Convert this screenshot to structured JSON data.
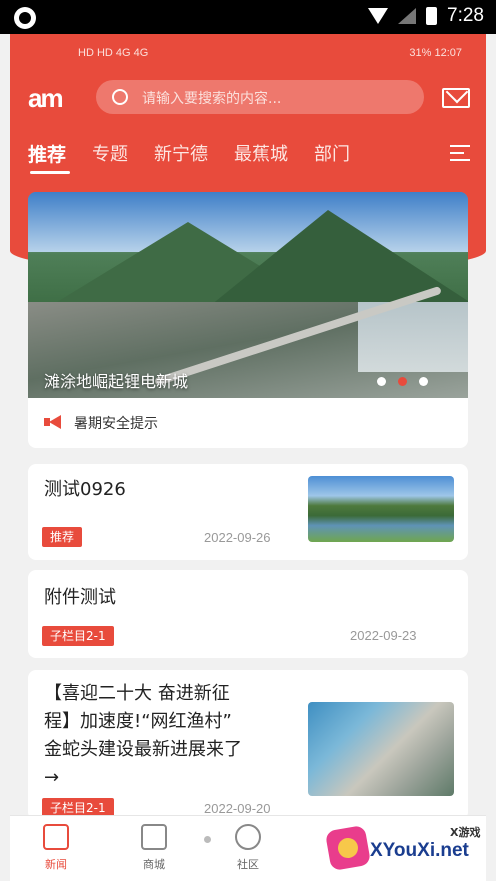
{
  "device_status": {
    "time": "7:28"
  },
  "inner_status": {
    "left": "HD HD 4G 4G",
    "right": "31% 12:07"
  },
  "header": {
    "logo_text": "am",
    "search_placeholder": "请输入要搜索的内容...",
    "icons": {
      "search": "search-icon",
      "mail": "mail-icon",
      "menu": "menu-icon"
    },
    "accent_color": "#e84b3c"
  },
  "tabs": [
    {
      "label": "推荐",
      "active": true
    },
    {
      "label": "专题"
    },
    {
      "label": "新宁德"
    },
    {
      "label": "最蕉城"
    },
    {
      "label": "部门"
    }
  ],
  "banner": {
    "caption": "滩涂地崛起锂电新城",
    "slides": 3,
    "active_slide": 2
  },
  "notice": {
    "text": "暑期安全提示"
  },
  "articles": [
    {
      "title": "测试0926",
      "tag": "推荐",
      "date": "2022-09-26",
      "has_thumb": true
    },
    {
      "title": "附件测试",
      "tag": "子栏目2-1",
      "date": "2022-09-23",
      "has_thumb": false
    },
    {
      "title_lines": [
        "【喜迎二十大 奋进新征",
        "程】加速度!“网红渔村”",
        "金蛇头建设最新进展来了",
        "→"
      ],
      "tag": "子栏目2-1",
      "date": "2022-09-20",
      "has_thumb": true
    }
  ],
  "bottom_nav": [
    {
      "label": "新闻",
      "icon": "news-icon",
      "active": true
    },
    {
      "label": "商城",
      "icon": "shop-icon"
    },
    {
      "label": "社区",
      "icon": "compass-icon"
    }
  ],
  "watermark": {
    "brand": "XYouXi.net",
    "small": "X游戏"
  }
}
